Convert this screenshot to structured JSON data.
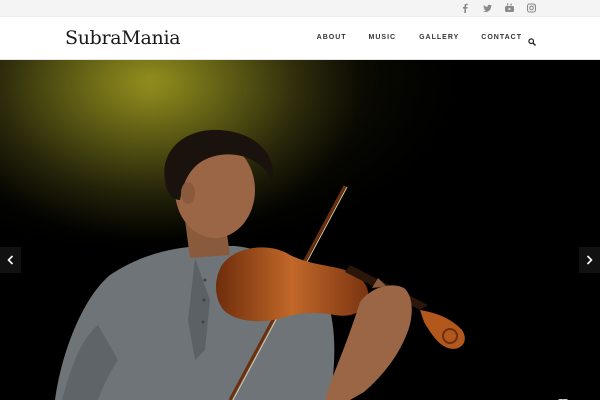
{
  "site": {
    "logo": "SubraMania"
  },
  "social": [
    {
      "icon": "facebook-icon"
    },
    {
      "icon": "twitter-icon"
    },
    {
      "icon": "youtube-icon"
    },
    {
      "icon": "instagram-icon"
    }
  ],
  "nav": {
    "about": "ABOUT",
    "music": "MUSIC",
    "gallery": "GALLERY",
    "contact": "CONTACT",
    "search_icon": "search-icon"
  },
  "hero": {
    "image": "violinist-on-stage",
    "prev_icon": "chevron-left-icon",
    "next_icon": "chevron-right-icon"
  },
  "colors": {
    "topbar": "#f4f4f4",
    "header": "#ffffff",
    "stage_light": "#7d7a18",
    "shirt": "#6f7478",
    "violin": "#a8511a"
  }
}
